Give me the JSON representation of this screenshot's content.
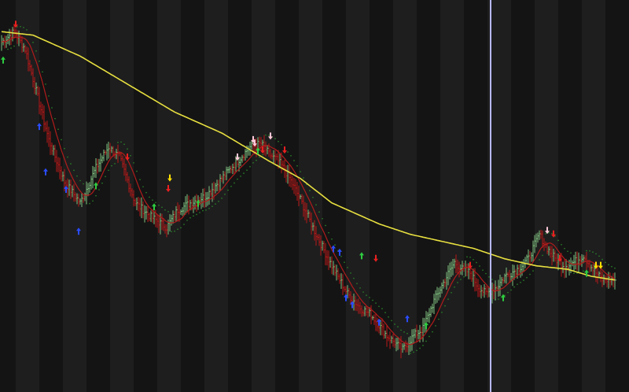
{
  "chart_data": {
    "type": "line",
    "x_range": [
      0,
      390
    ],
    "y_range": [
      0,
      100
    ],
    "cursor_x": 311,
    "grid": false,
    "colors": {
      "background": "#141414",
      "band_light": "#1e1e1e",
      "bar_up": "#7fbf7f",
      "bar_down": "#b81818",
      "sma_long": "#e8e040",
      "envelope": "#b01c1c",
      "trail": "#2a8a2a",
      "cursor": "#b8b8ff",
      "signal_up": "#2ecc40",
      "signal_down": "#e82020",
      "signal_low": "#2a4cff",
      "signal_high": "#ffc8d8",
      "signal_alert": "#ffe000"
    },
    "key_points": [
      [
        0,
        92
      ],
      [
        8,
        95
      ],
      [
        15,
        90
      ],
      [
        22,
        78
      ],
      [
        30,
        64
      ],
      [
        40,
        52
      ],
      [
        50,
        46
      ],
      [
        60,
        56
      ],
      [
        68,
        62
      ],
      [
        75,
        59
      ],
      [
        85,
        46
      ],
      [
        95,
        42
      ],
      [
        105,
        39
      ],
      [
        112,
        44
      ],
      [
        120,
        46
      ],
      [
        130,
        48
      ],
      [
        140,
        53
      ],
      [
        150,
        58
      ],
      [
        158,
        62
      ],
      [
        165,
        63
      ],
      [
        170,
        60
      ],
      [
        176,
        58
      ],
      [
        182,
        54
      ],
      [
        190,
        47
      ],
      [
        200,
        37
      ],
      [
        210,
        28
      ],
      [
        220,
        20
      ],
      [
        228,
        16
      ],
      [
        235,
        14
      ],
      [
        240,
        11
      ],
      [
        245,
        8
      ],
      [
        250,
        6
      ],
      [
        255,
        4
      ],
      [
        262,
        8
      ],
      [
        268,
        10
      ],
      [
        275,
        18
      ],
      [
        282,
        24
      ],
      [
        288,
        29
      ],
      [
        293,
        27
      ],
      [
        298,
        26
      ],
      [
        303,
        22
      ],
      [
        308,
        20
      ],
      [
        315,
        22
      ],
      [
        320,
        25
      ],
      [
        328,
        27
      ],
      [
        335,
        30
      ],
      [
        342,
        37
      ],
      [
        347,
        33
      ],
      [
        352,
        30
      ],
      [
        358,
        28
      ],
      [
        364,
        29
      ],
      [
        370,
        31
      ],
      [
        376,
        27
      ],
      [
        382,
        24
      ],
      [
        388,
        24
      ]
    ],
    "sma_points": [
      [
        0,
        95
      ],
      [
        20,
        94
      ],
      [
        50,
        88
      ],
      [
        80,
        80
      ],
      [
        110,
        72
      ],
      [
        140,
        66
      ],
      [
        170,
        58
      ],
      [
        190,
        53
      ],
      [
        210,
        46
      ],
      [
        240,
        40
      ],
      [
        260,
        37
      ],
      [
        280,
        35
      ],
      [
        300,
        33
      ],
      [
        320,
        30
      ],
      [
        340,
        28
      ],
      [
        360,
        27
      ],
      [
        375,
        25
      ],
      [
        389,
        24
      ]
    ],
    "signals": [
      {
        "x": 1,
        "y": 87,
        "kind": "up"
      },
      {
        "x": 9,
        "y": 97,
        "kind": "down"
      },
      {
        "x": 24,
        "y": 68,
        "kind": "low"
      },
      {
        "x": 28,
        "y": 55,
        "kind": "low"
      },
      {
        "x": 41,
        "y": 50,
        "kind": "low"
      },
      {
        "x": 49,
        "y": 38,
        "kind": "low"
      },
      {
        "x": 60,
        "y": 51,
        "kind": "up"
      },
      {
        "x": 80,
        "y": 59,
        "kind": "down"
      },
      {
        "x": 97,
        "y": 45,
        "kind": "up"
      },
      {
        "x": 106,
        "y": 50,
        "kind": "down"
      },
      {
        "x": 107,
        "y": 53,
        "kind": "alert"
      },
      {
        "x": 125,
        "y": 46,
        "kind": "up"
      },
      {
        "x": 150,
        "y": 59,
        "kind": "high"
      },
      {
        "x": 160,
        "y": 64,
        "kind": "high"
      },
      {
        "x": 161,
        "y": 63,
        "kind": "high"
      },
      {
        "x": 163,
        "y": 61,
        "kind": "up"
      },
      {
        "x": 166,
        "y": 61,
        "kind": "down"
      },
      {
        "x": 171,
        "y": 65,
        "kind": "high"
      },
      {
        "x": 180,
        "y": 61,
        "kind": "down"
      },
      {
        "x": 211,
        "y": 33,
        "kind": "low"
      },
      {
        "x": 215,
        "y": 32,
        "kind": "low"
      },
      {
        "x": 219,
        "y": 19,
        "kind": "low"
      },
      {
        "x": 223,
        "y": 17,
        "kind": "low"
      },
      {
        "x": 229,
        "y": 31,
        "kind": "up"
      },
      {
        "x": 238,
        "y": 30,
        "kind": "down"
      },
      {
        "x": 240,
        "y": 12,
        "kind": "low"
      },
      {
        "x": 258,
        "y": 13,
        "kind": "low"
      },
      {
        "x": 270,
        "y": 11,
        "kind": "up"
      },
      {
        "x": 298,
        "y": 28,
        "kind": "down"
      },
      {
        "x": 319,
        "y": 19,
        "kind": "up"
      },
      {
        "x": 347,
        "y": 38,
        "kind": "high"
      },
      {
        "x": 351,
        "y": 37,
        "kind": "down"
      },
      {
        "x": 355,
        "y": 30,
        "kind": "down"
      },
      {
        "x": 372,
        "y": 26,
        "kind": "up"
      },
      {
        "x": 378,
        "y": 28,
        "kind": "alert"
      },
      {
        "x": 381,
        "y": 28,
        "kind": "alert"
      }
    ]
  }
}
